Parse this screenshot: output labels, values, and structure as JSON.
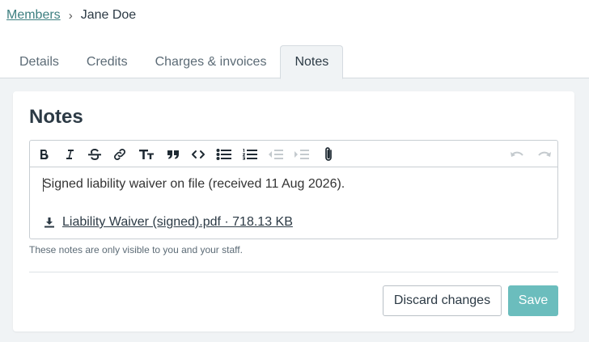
{
  "breadcrumb": {
    "parent": "Members",
    "separator": "›",
    "current": "Jane Doe"
  },
  "tabs": [
    {
      "label": "Details",
      "active": false
    },
    {
      "label": "Credits",
      "active": false
    },
    {
      "label": "Charges & invoices",
      "active": false
    },
    {
      "label": "Notes",
      "active": true
    }
  ],
  "card": {
    "title": "Notes",
    "toolbar_icons": [
      "bold-icon",
      "italic-icon",
      "strikethrough-icon",
      "link-icon",
      "heading-icon",
      "quote-icon",
      "code-icon",
      "bullet-list-icon",
      "numbered-list-icon",
      "outdent-icon",
      "indent-icon",
      "attach-file-icon",
      "undo-icon",
      "redo-icon"
    ],
    "editor": {
      "text": "Signed liability waiver on file (received 11 Aug 2026).",
      "attachment_label": "Liability Waiver (signed).pdf · 718.13 KB"
    },
    "hint": "These notes are only visible to you and your staff.",
    "discard_label": "Discard changes",
    "save_label": "Save"
  },
  "colors": {
    "accent": "#6bbdbd",
    "link": "#3d7f80",
    "background": "#f0f3f5"
  }
}
